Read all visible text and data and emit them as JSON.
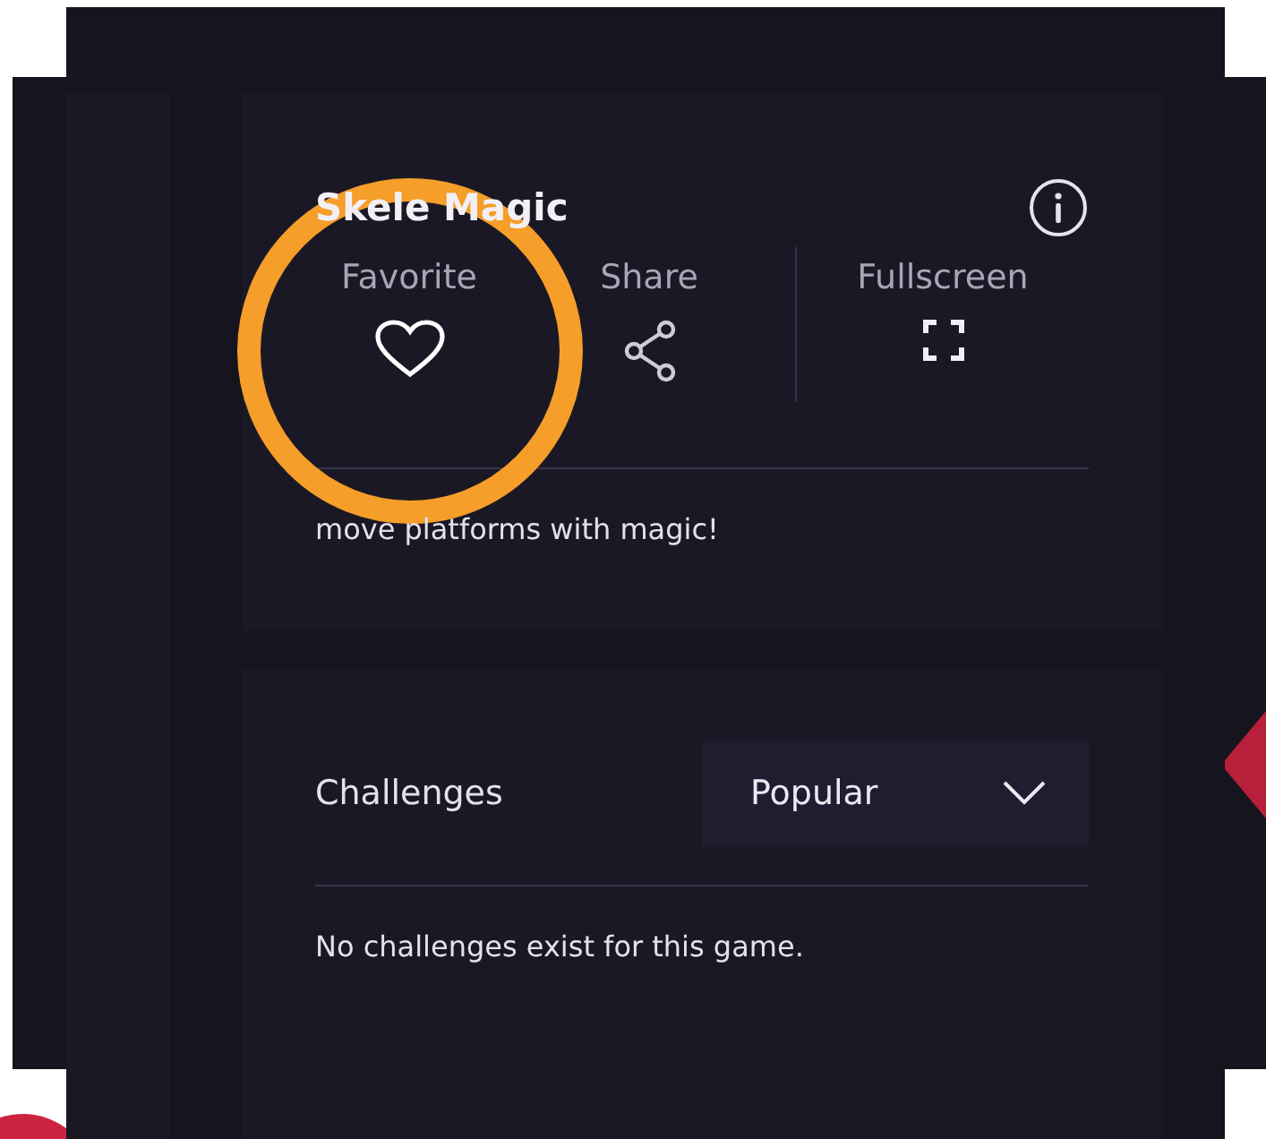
{
  "game": {
    "title": "Skele Magic",
    "description": "move platforms with magic!",
    "actions": [
      {
        "kind": "favorite",
        "label": "Favorite",
        "favorited": false
      },
      {
        "kind": "share",
        "label": "Share"
      },
      {
        "kind": "fullscreen",
        "label": "Fullscreen"
      }
    ]
  },
  "challenges": {
    "title": "Challenges",
    "sort": {
      "value": "Popular"
    },
    "empty_message": "No challenges exist for this game."
  },
  "annotation": {
    "kind": "circle",
    "color": "#f59e2a"
  }
}
